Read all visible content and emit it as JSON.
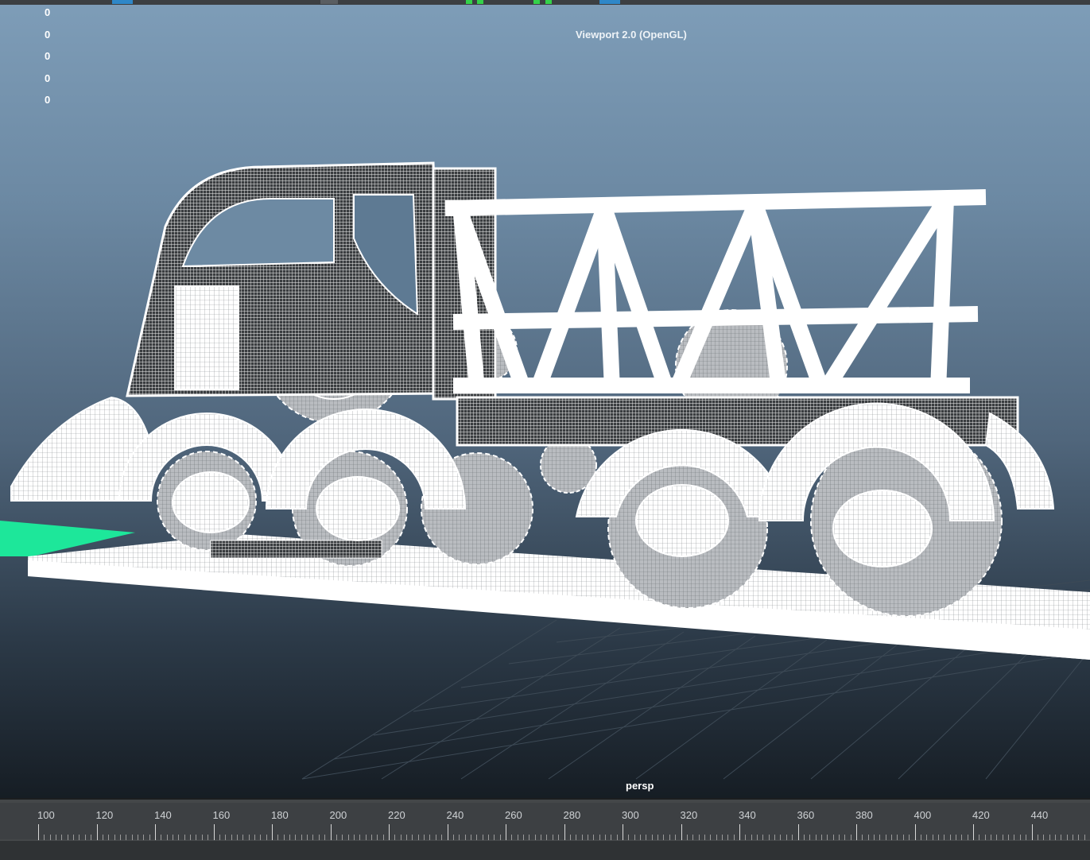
{
  "viewport": {
    "renderer_label": "Viewport 2.0 (OpenGL)",
    "camera_label": "persp",
    "hud_values": [
      "0",
      "0",
      "0",
      "0",
      "0"
    ]
  },
  "timeline": {
    "ticks": [
      "100",
      "120",
      "140",
      "160",
      "180",
      "200",
      "220",
      "240",
      "260",
      "280",
      "300",
      "320",
      "340",
      "360",
      "380",
      "400",
      "420",
      "440"
    ]
  },
  "colors": {
    "wireframe": "#ffffff",
    "ground_highlight": "#1de79a",
    "gradient_top": "#7e9db8",
    "gradient_bottom": "#161d24"
  }
}
